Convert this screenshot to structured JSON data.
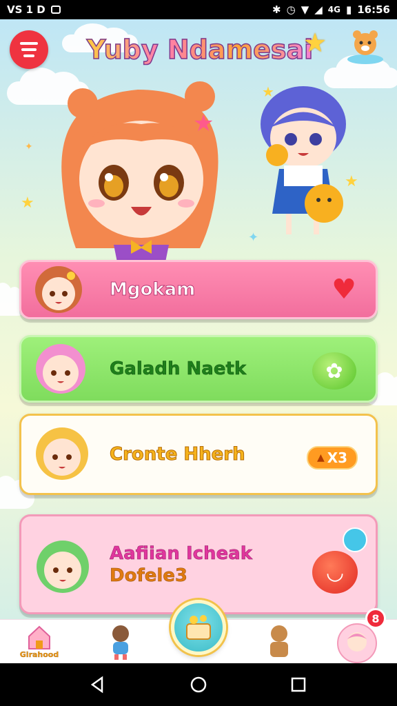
{
  "status_bar": {
    "left_text": "VS 1 D",
    "right_text": "16:56",
    "signal_label": "4G"
  },
  "header": {
    "title": "Yuby Ndamesai",
    "menu_icon": "menu-icon",
    "mascot_icon": "mascot-icon"
  },
  "cards": [
    {
      "label": "Mgokam",
      "action_icon": "heart-icon",
      "bg": "#f26e9d"
    },
    {
      "label": "Galadh Naetk",
      "action_icon": "sparkle-icon",
      "bg": "#7fdc5d"
    },
    {
      "label": "Cronte Hherh",
      "badge": "X3",
      "action_icon": "candle-icon",
      "bg": "#fffdf6"
    },
    {
      "label_line1": "Aafiian Icheak",
      "label_line2": "Dofele3",
      "action_icon": "smile-icon",
      "bg": "#ffd2e1"
    }
  ],
  "tab_bar": {
    "home_label": "Girahood",
    "notification_count": "8"
  },
  "colors": {
    "accent_red": "#ef3340",
    "accent_pink": "#f26e9d",
    "accent_green": "#7fdc5d",
    "accent_orange": "#ff9b21"
  }
}
